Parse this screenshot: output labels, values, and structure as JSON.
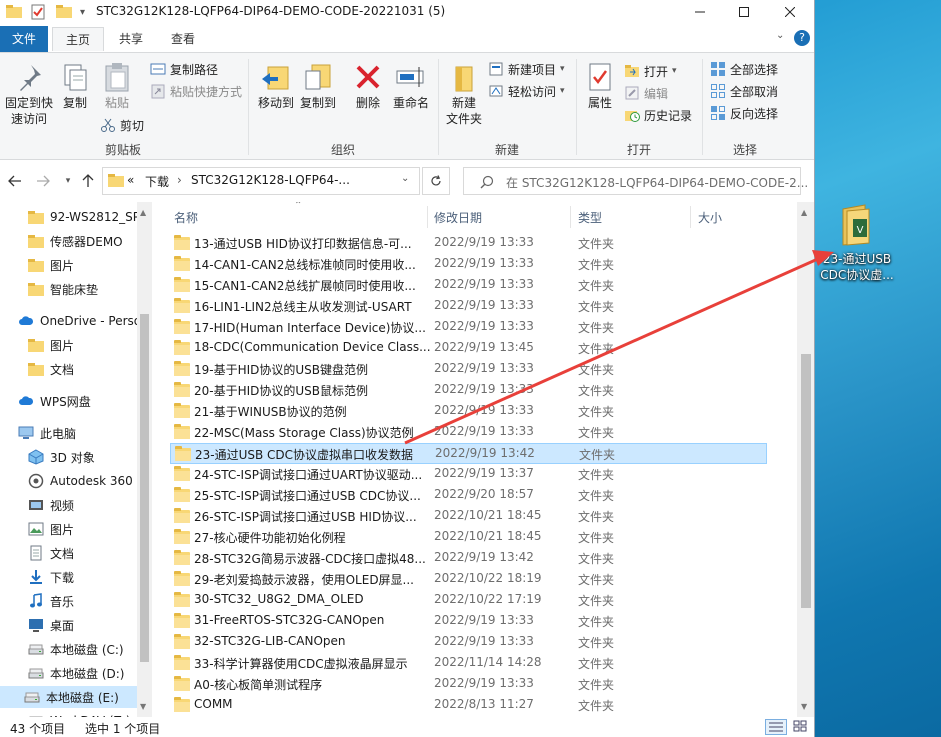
{
  "window": {
    "title": "STC32G12K128-LQFP64-DIP64-DEMO-CODE-20221031 (5)"
  },
  "ribbon_tabs": [
    "文件",
    "主页",
    "共享",
    "查看"
  ],
  "ribbon": {
    "clipboard": {
      "label": "剪贴板",
      "pin": "固定到快\n速访问",
      "copy": "复制",
      "paste": "粘贴",
      "copy_path": "复制路径",
      "paste_shortcut": "粘贴快捷方式",
      "cut": "剪切"
    },
    "organize": {
      "label": "组织",
      "move_to": "移动到",
      "copy_to": "复制到",
      "delete": "删除",
      "rename": "重命名"
    },
    "new": {
      "label": "新建",
      "new_folder": "新建\n文件夹",
      "new_item": "新建项目",
      "easy_access": "轻松访问"
    },
    "open": {
      "label": "打开",
      "properties": "属性",
      "open": "打开",
      "edit": "编辑",
      "history": "历史记录"
    },
    "select": {
      "label": "选择",
      "select_all": "全部选择",
      "select_none": "全部取消",
      "invert": "反向选择"
    }
  },
  "address": {
    "prefix": "«",
    "crumb1": "下载",
    "crumb2": "STC32G12K128-LQFP64-...",
    "search_placeholder": "在 STC32G12K128-LQFP64-DIP64-DEMO-CODE-2..."
  },
  "nav": {
    "items": [
      {
        "label": "92-WS2812_SP",
        "icon": "folder-icon"
      },
      {
        "label": "传感器DEMO",
        "icon": "folder-icon"
      },
      {
        "label": "图片",
        "icon": "folder-icon"
      },
      {
        "label": "智能床垫",
        "icon": "folder-icon"
      },
      {
        "label": "OneDrive - Perso",
        "icon": "cloud-icon"
      },
      {
        "label": "图片",
        "icon": "folder-icon"
      },
      {
        "label": "文档",
        "icon": "folder-icon"
      },
      {
        "label": "WPS网盘",
        "icon": "cloud-icon"
      },
      {
        "label": "此电脑",
        "icon": "computer-icon"
      },
      {
        "label": "3D 对象",
        "icon": "cube-icon"
      },
      {
        "label": "Autodesk 360",
        "icon": "autodesk-icon"
      },
      {
        "label": "视频",
        "icon": "video-icon"
      },
      {
        "label": "图片",
        "icon": "picture-icon"
      },
      {
        "label": "文档",
        "icon": "document-icon"
      },
      {
        "label": "下载",
        "icon": "download-icon"
      },
      {
        "label": "音乐",
        "icon": "music-icon"
      },
      {
        "label": "桌面",
        "icon": "desktop-icon"
      },
      {
        "label": "本地磁盘 (C:)",
        "icon": "drive-icon"
      },
      {
        "label": "本地磁盘 (D:)",
        "icon": "drive-icon"
      },
      {
        "label": "本地磁盘 (E:)",
        "icon": "drive-icon"
      },
      {
        "label": "WorkDAV (Z:)",
        "icon": "drive-icon"
      }
    ]
  },
  "columns": {
    "name": "名称",
    "date": "修改日期",
    "type": "类型",
    "size": "大小"
  },
  "files": [
    {
      "name": "13-通过USB HID协议打印数据信息-可...",
      "date": "2022/9/19 13:33",
      "type": "文件夹"
    },
    {
      "name": "14-CAN1-CAN2总线标准帧同时使用收...",
      "date": "2022/9/19 13:33",
      "type": "文件夹"
    },
    {
      "name": "15-CAN1-CAN2总线扩展帧同时使用收...",
      "date": "2022/9/19 13:33",
      "type": "文件夹"
    },
    {
      "name": "16-LIN1-LIN2总线主从收发测试-USART",
      "date": "2022/9/19 13:33",
      "type": "文件夹"
    },
    {
      "name": "17-HID(Human Interface Device)协议...",
      "date": "2022/9/19 13:33",
      "type": "文件夹"
    },
    {
      "name": "18-CDC(Communication Device Class...",
      "date": "2022/9/19 13:45",
      "type": "文件夹"
    },
    {
      "name": "19-基于HID协议的USB键盘范例",
      "date": "2022/9/19 13:33",
      "type": "文件夹"
    },
    {
      "name": "20-基于HID协议的USB鼠标范例",
      "date": "2022/9/19 13:33",
      "type": "文件夹"
    },
    {
      "name": "21-基于WINUSB协议的范例",
      "date": "2022/9/19 13:33",
      "type": "文件夹"
    },
    {
      "name": "22-MSC(Mass Storage Class)协议范例",
      "date": "2022/9/19 13:33",
      "type": "文件夹"
    },
    {
      "name": "23-通过USB CDC协议虚拟串口收发数据",
      "date": "2022/9/19 13:42",
      "type": "文件夹"
    },
    {
      "name": "24-STC-ISP调试接口通过UART协议驱动...",
      "date": "2022/9/19 13:37",
      "type": "文件夹"
    },
    {
      "name": "25-STC-ISP调试接口通过USB CDC协议...",
      "date": "2022/9/20 18:57",
      "type": "文件夹"
    },
    {
      "name": "26-STC-ISP调试接口通过USB HID协议...",
      "date": "2022/10/21 18:45",
      "type": "文件夹"
    },
    {
      "name": "27-核心硬件功能初始化例程",
      "date": "2022/10/21 18:45",
      "type": "文件夹"
    },
    {
      "name": "28-STC32G简易示波器-CDC接口虚拟48...",
      "date": "2022/9/19 13:42",
      "type": "文件夹"
    },
    {
      "name": "29-老刘爱捣鼓示波器，使用OLED屏显...",
      "date": "2022/10/22 18:19",
      "type": "文件夹"
    },
    {
      "name": "30-STC32_U8G2_DMA_OLED",
      "date": "2022/10/22 17:19",
      "type": "文件夹"
    },
    {
      "name": "31-FreeRTOS-STC32G-CANOpen",
      "date": "2022/9/19 13:33",
      "type": "文件夹"
    },
    {
      "name": "32-STC32G-LIB-CANOpen",
      "date": "2022/9/19 13:33",
      "type": "文件夹"
    },
    {
      "name": "33-科学计算器使用CDC虚拟液晶屏显示",
      "date": "2022/11/14 14:28",
      "type": "文件夹"
    },
    {
      "name": "A0-核心板简单测试程序",
      "date": "2022/9/19 13:33",
      "type": "文件夹"
    },
    {
      "name": "COMM",
      "date": "2022/8/13 11:27",
      "type": "文件夹"
    }
  ],
  "selected_index": 10,
  "status": {
    "count": "43 个项目",
    "selected": "选中 1 个项目"
  },
  "desktop_icon": {
    "label": "23-通过USB\nCDC协议虚..."
  },
  "colors": {
    "accent": "#1a6fb5",
    "selection": "#cce8ff",
    "arrow": "#e8403a"
  }
}
